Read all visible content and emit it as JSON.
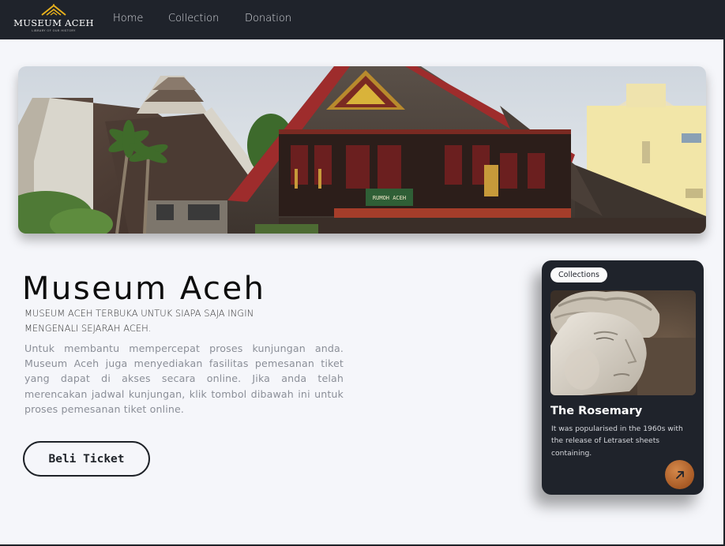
{
  "nav": {
    "logo_name": "MUSEUM ACEH",
    "logo_tag": "LIBRARY OF OUR HISTORY",
    "links": [
      "Home",
      "Collection",
      "Donation"
    ]
  },
  "hero": {
    "image": "museum-aceh-rumoh-aceh-photo",
    "sign_text": "RUMOH ACEH"
  },
  "main": {
    "title": "Museum Aceh",
    "subtitle": "MUSEUM ACEH TERBUKA UNTUK SIAPA SAJA INGIN MENGENALI SEJARAH ACEH.",
    "description": "Untuk membantu mempercepat proses kunjungan anda. Museum Aceh juga menyediakan fasilitas pemesanan tiket yang dapat di akses secara online. Jika anda telah merencakan jadwal kunjungan, klik tombol dibawah ini untuk proses pemesanan tiket online.",
    "button_label": "Beli Ticket"
  },
  "card": {
    "badge": "Collections",
    "image": "marble-statue-head-photo",
    "title": "The Rosemary",
    "text": "It was popularised in the 1960s with the release of Letraset sheets containing.",
    "arrow_icon": "arrow-up-right-icon"
  },
  "colors": {
    "navbar": "#1f232b",
    "background": "#f5f6fa",
    "card": "#1f232b",
    "accent": "#c0702f",
    "logo_gold": "#e8b11d"
  }
}
